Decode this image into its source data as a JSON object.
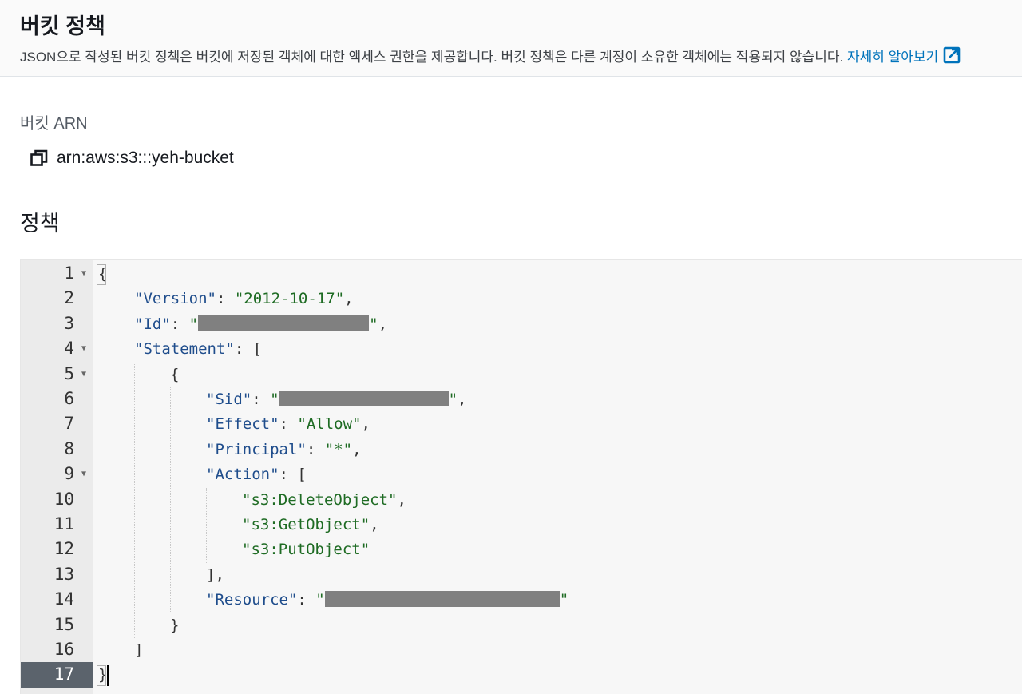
{
  "header": {
    "title": "버킷 정책",
    "description": "JSON으로 작성된 버킷 정책은 버킷에 저장된 객체에 대한 액세스 권한을 제공합니다. 버킷 정책은 다른 계정이 소유한 객체에는 적용되지 않습니다.",
    "learn_more_link": "자세히 알아보기"
  },
  "arn": {
    "label": "버킷 ARN",
    "value": "arn:aws:s3:::yeh-bucket"
  },
  "policy": {
    "label": "정책",
    "active_line": 17,
    "foldable_lines": [
      1,
      4,
      5,
      9
    ],
    "lines": [
      "{",
      "\"Version\": \"2012-10-17\",",
      "\"Id\": \"[redacted]\",",
      "\"Statement\": [",
      "{",
      "\"Sid\": \"[redacted]\",",
      "\"Effect\": \"Allow\",",
      "\"Principal\": \"*\",",
      "\"Action\": [",
      "\"s3:DeleteObject\",",
      "\"s3:GetObject\",",
      "\"s3:PutObject\"",
      "],",
      "\"Resource\": \"[redacted]\"",
      "}",
      "]",
      "}"
    ]
  },
  "colors": {
    "link": "#0073bb",
    "json_key": "#1f4d8c",
    "json_string": "#1e6b23",
    "gutter_active": "#5b636c"
  }
}
